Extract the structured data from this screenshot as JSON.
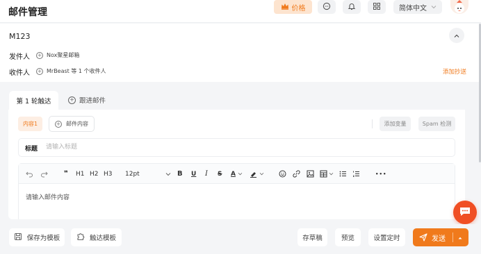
{
  "header": {
    "title": "邮件管理",
    "price_label": "价格",
    "language": "简体中文",
    "icons": [
      "crown-icon",
      "chat-icon",
      "bell-icon",
      "grid-icon",
      "chevron-down-icon"
    ]
  },
  "mail": {
    "id": "M123",
    "sender_label": "发件人",
    "sender_value": "Nox聚星邮箱",
    "recipient_label": "收件人",
    "recipient_value": "MrBeast 等 1 个收件人",
    "add_cc": "添加抄送"
  },
  "tabs": [
    {
      "label": "第 1 轮触达",
      "active": true
    },
    {
      "label": "跟进邮件",
      "active": false
    }
  ],
  "content": {
    "tag_label": "内容1",
    "add_content_label": "邮件内容",
    "add_variable": "添加变量",
    "spam_check": "Spam 检测"
  },
  "subject": {
    "label": "标题",
    "placeholder": "请输入标题"
  },
  "editor": {
    "toolbar": {
      "quote": "❞",
      "h1": "H1",
      "h2": "H2",
      "h3": "H3",
      "font_size": "12pt",
      "bold": "B",
      "underline": "U",
      "italic": "I",
      "strike": "S",
      "font_color_letter": "A",
      "more": "•••"
    },
    "placeholder": "请输入邮件内容"
  },
  "footer": {
    "save_template": "保存为模板",
    "reach_template": "触达模板",
    "draft": "存草稿",
    "preview": "预览",
    "schedule": "设置定时",
    "send": "发送"
  },
  "colors": {
    "accent": "#f07a1c",
    "accent_light": "#fde4cf",
    "chat_bubble": "#f04f24"
  }
}
